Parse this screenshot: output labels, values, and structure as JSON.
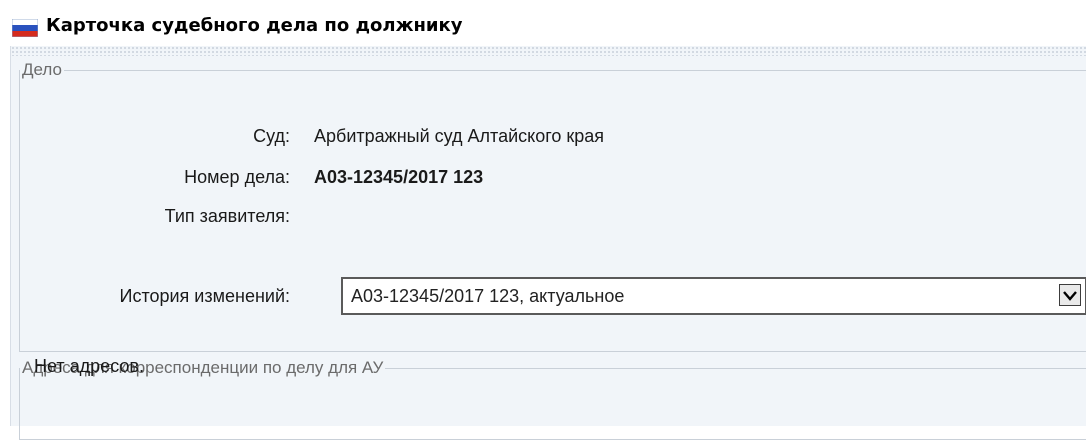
{
  "window": {
    "title": "Карточка судебного дела по должнику",
    "icon": "russian-flag-icon"
  },
  "case_section": {
    "legend": "Дело",
    "court_label": "Суд:",
    "court_value": "Арбитражный суд Алтайского края",
    "case_number_label": "Номер дела:",
    "case_number_value": "А03-12345/2017 123",
    "applicant_type_label": "Тип заявителя:",
    "applicant_type_value": "",
    "history_label": "История изменений:",
    "history_selected": "А03-12345/2017 123, актуальное"
  },
  "address_section": {
    "legend": "Адреса для корреспонденции по делу для АУ",
    "empty_text": "Нет адресов."
  },
  "colors": {
    "panel_background": "#f1f5f9",
    "border": "#c9d0d8",
    "legend_text": "#6b6b6b"
  }
}
